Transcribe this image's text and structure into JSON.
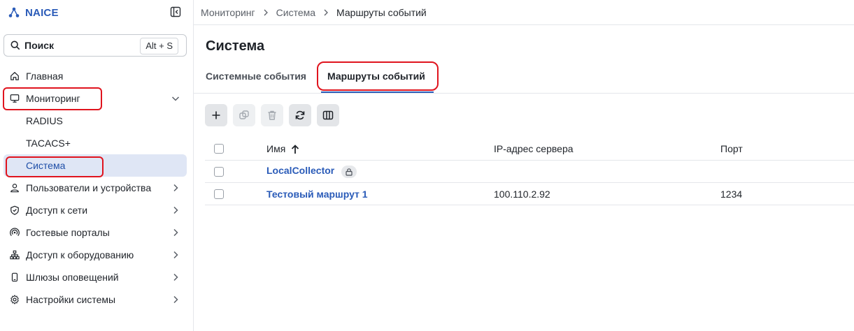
{
  "app": {
    "name": "NAICE"
  },
  "search": {
    "label": "Поиск",
    "shortcut": "Alt + S"
  },
  "sidebar": {
    "items": [
      {
        "label": "Главная",
        "icon": "home-icon"
      },
      {
        "label": "Мониторинг",
        "icon": "monitor-icon",
        "expanded": true
      },
      {
        "label": "Пользователи и устройства",
        "icon": "user-icon"
      },
      {
        "label": "Доступ к сети",
        "icon": "shield-icon"
      },
      {
        "label": "Гостевые порталы",
        "icon": "wireless-icon"
      },
      {
        "label": "Доступ к оборудованию",
        "icon": "network-icon"
      },
      {
        "label": "Шлюзы оповещений",
        "icon": "phone-icon"
      },
      {
        "label": "Настройки системы",
        "icon": "gear-icon"
      }
    ],
    "monitoring_sub": [
      {
        "label": "RADIUS"
      },
      {
        "label": "TACACS+"
      },
      {
        "label": "Система",
        "active": true
      }
    ]
  },
  "breadcrumb": [
    "Мониторинг",
    "Система",
    "Маршруты событий"
  ],
  "page": {
    "title": "Система"
  },
  "tabs": [
    {
      "label": "Системные события"
    },
    {
      "label": "Маршруты событий",
      "active": true
    }
  ],
  "toolbar": [
    {
      "icon": "plus-icon",
      "enabled": true
    },
    {
      "icon": "copy-icon",
      "enabled": false
    },
    {
      "icon": "trash-icon",
      "enabled": false
    },
    {
      "icon": "refresh-icon",
      "enabled": true
    },
    {
      "icon": "columns-icon",
      "enabled": true
    }
  ],
  "table": {
    "columns": [
      "Имя",
      "IP-адрес сервера",
      "Порт"
    ],
    "sort": {
      "column": "Имя",
      "direction": "asc"
    },
    "rows": [
      {
        "name": "LocalCollector",
        "ip": "",
        "port": "",
        "locked": true
      },
      {
        "name": "Тестовый маршрут 1",
        "ip": "100.110.2.92",
        "port": "1234",
        "locked": false
      }
    ]
  },
  "colors": {
    "accent": "#2a5bb8",
    "highlight": "#e0141e",
    "active_bg": "#dfe6f5"
  }
}
